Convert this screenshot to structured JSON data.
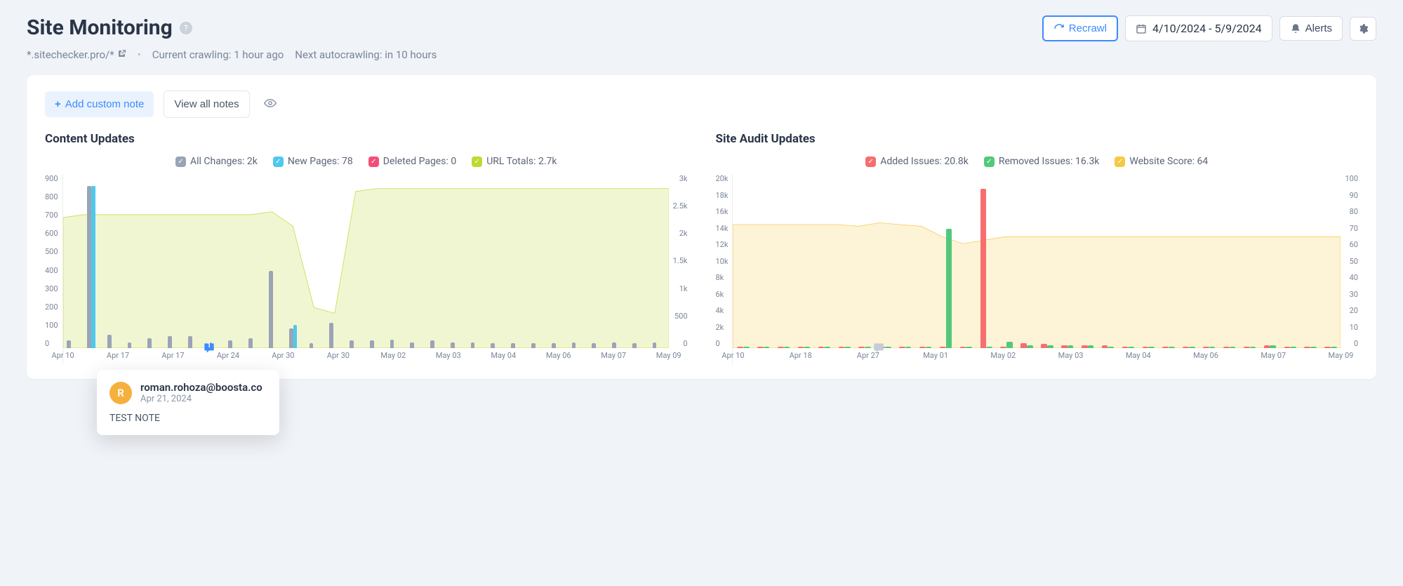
{
  "header": {
    "title": "Site Monitoring",
    "recrawl_label": "Recrawl",
    "date_range": "4/10/2024 - 5/9/2024",
    "alerts_label": "Alerts"
  },
  "subheader": {
    "domain": "*.sitechecker.pro/*",
    "crawl_status": "Current crawling: 1 hour ago",
    "next_crawl": "Next autocrawling: in 10 hours"
  },
  "notes": {
    "add_label": "Add custom note",
    "view_label": "View all notes",
    "popup": {
      "avatar_initial": "R",
      "user": "roman.rohoza@boosta.co",
      "date": "Apr 21, 2024",
      "body": "TEST NOTE",
      "marker_count": "1"
    }
  },
  "chart_left": {
    "title": "Content Updates",
    "legend_all": "All Changes: 2k",
    "legend_new": "New Pages: 78",
    "legend_deleted": "Deleted Pages: 0",
    "legend_url": "URL Totals: 2.7k"
  },
  "chart_right": {
    "title": "Site Audit Updates",
    "legend_added": "Added Issues: 20.8k",
    "legend_removed": "Removed Issues: 16.3k",
    "legend_score": "Website Score: 64"
  },
  "colors": {
    "grey": "#9aa4b5",
    "cyan": "#4fc8ee",
    "pink": "#f54d7a",
    "lime": "#c1d830",
    "lime_fill": "rgba(193,216,48,0.22)",
    "red": "#f76e6e",
    "green": "#52c97a",
    "yellow": "#f6c944",
    "yellow_fill": "rgba(246,201,68,0.22)"
  },
  "chart_data": [
    {
      "id": "content_updates",
      "type": "bar+line",
      "title": "Content Updates",
      "x_labels": [
        "Apr 10",
        "Apr 17",
        "Apr 17",
        "Apr 24",
        "Apr 30",
        "Apr 30",
        "May 02",
        "May 03",
        "May 04",
        "May 06",
        "May 07",
        "May 09"
      ],
      "y_left": {
        "label": "",
        "min": 0,
        "max": 900,
        "ticks": [
          0,
          100,
          200,
          300,
          400,
          500,
          600,
          700,
          800,
          900
        ]
      },
      "y_right": {
        "label": "",
        "min": 0,
        "max": 3000,
        "ticks": [
          "0",
          "500",
          "1k",
          "1.5k",
          "2k",
          "2.5k",
          "3k"
        ]
      },
      "series": [
        {
          "name": "All Changes",
          "type": "bar",
          "axis": "left",
          "color": "grey",
          "values": [
            40,
            840,
            70,
            30,
            50,
            60,
            60,
            30,
            40,
            50,
            400,
            100,
            25,
            130,
            40,
            40,
            45,
            30,
            40,
            30,
            30,
            25,
            25,
            25,
            25,
            30,
            25,
            30,
            25,
            30
          ]
        },
        {
          "name": "New Pages",
          "type": "bar",
          "axis": "left",
          "color": "cyan",
          "values": [
            0,
            840,
            0,
            0,
            0,
            0,
            0,
            0,
            0,
            0,
            0,
            120,
            0,
            0,
            0,
            0,
            0,
            0,
            0,
            0,
            0,
            0,
            0,
            0,
            0,
            0,
            0,
            0,
            0,
            0
          ]
        },
        {
          "name": "Deleted Pages",
          "type": "bar",
          "axis": "left",
          "color": "pink",
          "values": [
            0,
            0,
            0,
            0,
            0,
            0,
            0,
            0,
            0,
            0,
            0,
            0,
            0,
            0,
            0,
            0,
            0,
            0,
            0,
            0,
            0,
            0,
            0,
            0,
            0,
            0,
            0,
            0,
            0,
            0
          ]
        },
        {
          "name": "URL Totals",
          "type": "area",
          "axis": "right",
          "color": "lime",
          "values": [
            2250,
            2300,
            2300,
            2300,
            2300,
            2300,
            2300,
            2300,
            2300,
            2300,
            2350,
            2100,
            700,
            600,
            2700,
            2750,
            2750,
            2750,
            2750,
            2750,
            2750,
            2750,
            2750,
            2750,
            2750,
            2750,
            2750,
            2750,
            2750,
            2750
          ]
        }
      ]
    },
    {
      "id": "site_audit_updates",
      "type": "bar+line",
      "title": "Site Audit Updates",
      "x_labels": [
        "Apr 10",
        "Apr 18",
        "Apr 27",
        "May 01",
        "May 02",
        "May 03",
        "May 04",
        "May 06",
        "May 07",
        "May 09"
      ],
      "y_left": {
        "label": "",
        "min": 0,
        "max": 20000,
        "ticks": [
          "0",
          "2k",
          "4k",
          "6k",
          "8k",
          "10k",
          "12k",
          "14k",
          "16k",
          "18k",
          "20k"
        ]
      },
      "y_right": {
        "label": "",
        "min": 0,
        "max": 100,
        "ticks": [
          0,
          10,
          20,
          30,
          40,
          50,
          60,
          70,
          80,
          90,
          100
        ]
      },
      "series": [
        {
          "name": "Added Issues",
          "type": "bar",
          "axis": "left",
          "color": "red",
          "values": [
            200,
            200,
            200,
            200,
            200,
            200,
            200,
            200,
            200,
            200,
            200,
            200,
            18300,
            200,
            600,
            500,
            300,
            300,
            300,
            200,
            200,
            200,
            200,
            200,
            200,
            200,
            300,
            200,
            200,
            200
          ]
        },
        {
          "name": "Removed Issues",
          "type": "bar",
          "axis": "left",
          "color": "green",
          "values": [
            150,
            150,
            150,
            150,
            150,
            150,
            150,
            150,
            150,
            150,
            13700,
            150,
            150,
            700,
            300,
            300,
            300,
            300,
            200,
            200,
            200,
            200,
            200,
            200,
            200,
            200,
            300,
            200,
            200,
            200
          ]
        },
        {
          "name": "Website Score",
          "type": "area",
          "axis": "right",
          "color": "yellow",
          "values": [
            71,
            71,
            71,
            71,
            71,
            71,
            70,
            72,
            71,
            70,
            64,
            60,
            62,
            64,
            64,
            64,
            64,
            64,
            64,
            64,
            64,
            64,
            64,
            64,
            64,
            64,
            64,
            64,
            64,
            64
          ]
        }
      ]
    }
  ]
}
